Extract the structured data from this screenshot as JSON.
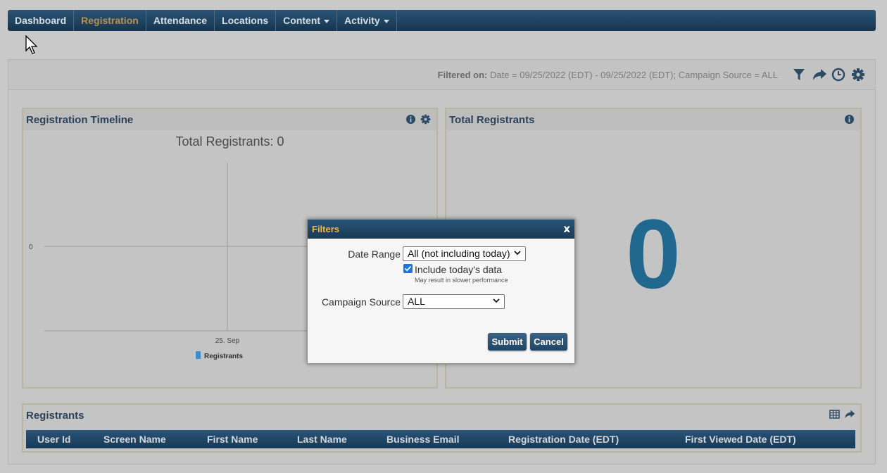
{
  "nav": {
    "items": [
      {
        "label": "Dashboard",
        "active": false,
        "dropdown": false
      },
      {
        "label": "Registration",
        "active": true,
        "dropdown": false
      },
      {
        "label": "Attendance",
        "active": false,
        "dropdown": false
      },
      {
        "label": "Locations",
        "active": false,
        "dropdown": false
      },
      {
        "label": "Content",
        "active": false,
        "dropdown": true
      },
      {
        "label": "Activity",
        "active": false,
        "dropdown": true
      }
    ]
  },
  "filter_bar": {
    "label": "Filtered on:",
    "value": "Date = 09/25/2022 (EDT) - 09/25/2022 (EDT); Campaign Source = ALL",
    "icons": [
      "filter-icon",
      "share-icon",
      "clock-icon",
      "gear-icon"
    ]
  },
  "timeline_panel": {
    "title": "Registration Timeline",
    "icons": [
      "info-icon",
      "gear-icon"
    ],
    "chart_title": "Total Registrants: 0",
    "chart_data": {
      "type": "bar",
      "title": "Total Registrants: 0",
      "categories": [
        "25. Sep"
      ],
      "series": [
        {
          "name": "Registrants",
          "values": [
            0
          ]
        }
      ],
      "y_tick_labels": [
        "0"
      ],
      "color": "#3f8ec9"
    }
  },
  "total_panel": {
    "title": "Total Registrants",
    "icons": [
      "info-icon"
    ],
    "value": "0"
  },
  "registrants_panel": {
    "title": "Registrants",
    "icons": [
      "table-icon",
      "share-icon"
    ],
    "columns": [
      "User Id",
      "Screen Name",
      "First Name",
      "Last Name",
      "Business Email",
      "Registration Date (EDT)",
      "First Viewed Date (EDT)"
    ]
  },
  "modal": {
    "title": "Filters",
    "close_label": "x",
    "date_range_label": "Date Range",
    "date_range_value": "All (not including today)",
    "include_today_label": "Include today's data",
    "include_today_checked": true,
    "include_today_hint": "May result in slower performance",
    "campaign_source_label": "Campaign Source",
    "campaign_source_value": "ALL",
    "submit_label": "Submit",
    "cancel_label": "Cancel"
  },
  "colors": {
    "nav_bg": "#1f4565",
    "nav_active": "#b7924a",
    "accent_blue": "#21688f",
    "modal_title": "#f0b746"
  }
}
